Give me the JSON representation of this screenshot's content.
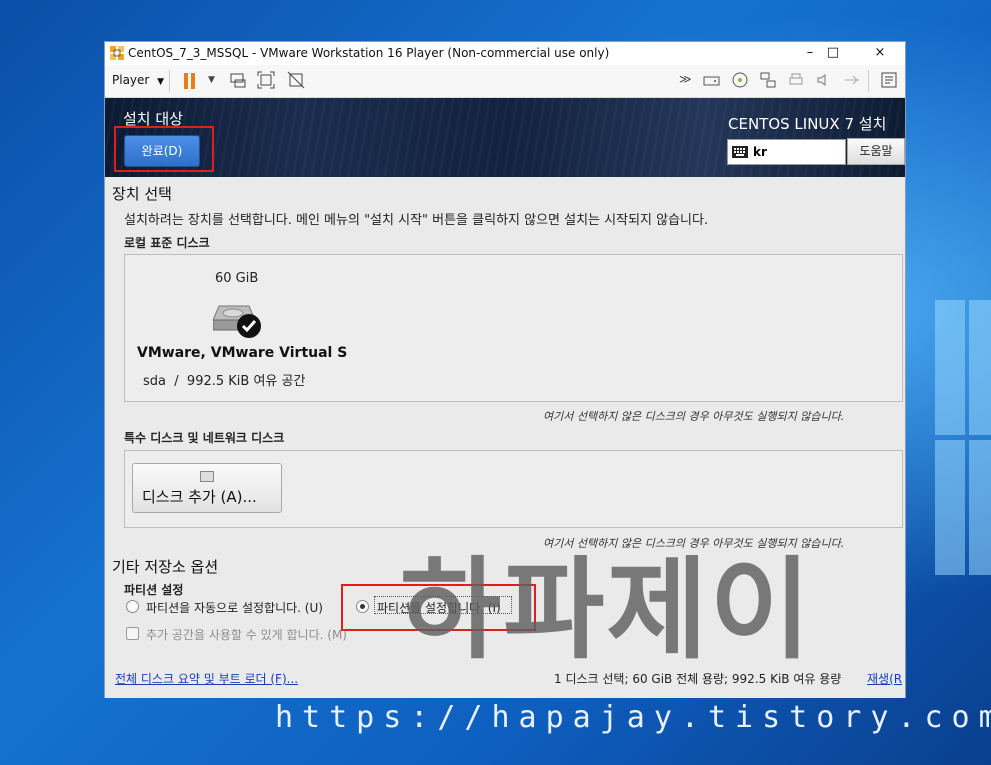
{
  "window": {
    "title": "CentOS_7_3_MSSQL - VMware Workstation 16 Player (Non-commercial use only)",
    "minimize": "–",
    "maximize": "□",
    "close": "×"
  },
  "toolbar": {
    "player_menu": "Player",
    "more": "≫"
  },
  "installer": {
    "page_title": "설치 대상",
    "done_button": "완료(D)",
    "product_title": "CENTOS LINUX 7 설치",
    "keyboard_layout": "kr",
    "help_button": "도움말"
  },
  "device_selection": {
    "title": "장치 선택",
    "description": "설치하려는 장치를 선택합니다. 메인 메뉴의 \"설치 시작\" 버튼을 클릭하지 않으면 설치는 시작되지 않습니다.",
    "local_disks_label": "로컬 표준 디스크",
    "disk": {
      "size": "60 GiB",
      "name": "VMware, VMware Virtual S",
      "device": "sda",
      "separator": "/",
      "free": "992.5 KiB 여유 공간"
    },
    "local_note": "여기서 선택하지 않은 디스크의 경우 아무것도 실행되지 않습니다.",
    "special_disks_label": "특수 디스크 및 네트워크 디스크",
    "add_disk_button": "디스크 추가 (A)...",
    "special_note": "여기서 선택하지 않은 디스크의 경우 아무것도 실행되지 않습니다."
  },
  "other_storage": {
    "title": "기타 저장소 옵션",
    "partition_label": "파티션 설정",
    "auto_option": "파티션을 자동으로 설정합니다. (U)",
    "manual_option": "파티션을 설정합니다. (I)",
    "selected": "manual",
    "extra_space_option": "추가 공간을 사용할 수 있게 합니다. (M)"
  },
  "footer": {
    "summary_link": "전체 디스크 요약 및 부트 로더 (F)...",
    "summary": "1 디스크 선택; 60 GiB 전체 용량; 992.5 KiB 여유 용량",
    "refresh_link": "재생(R"
  },
  "watermark": {
    "korean": "하파제이",
    "url": "https://hapajay.tistory.com/"
  },
  "colors": {
    "desktop": "#1e6fc8",
    "header": "#12223f",
    "done_button": "#3d7fd8",
    "highlight_box": "#e21d1d",
    "link": "#1a3fb5"
  }
}
